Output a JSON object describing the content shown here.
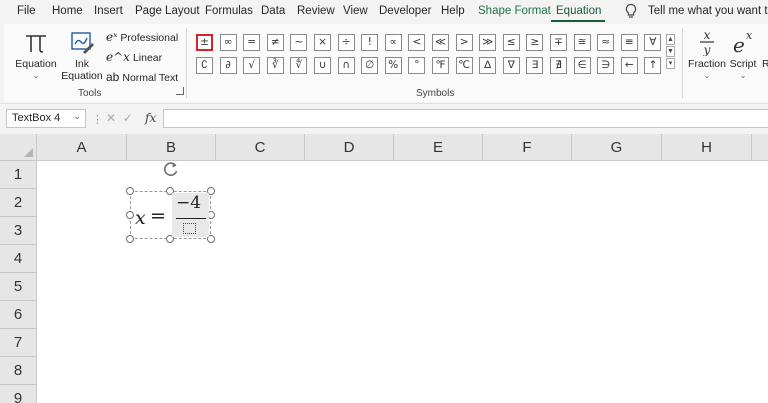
{
  "menu": {
    "tabs": [
      "File",
      "Home",
      "Insert",
      "Page Layout",
      "Formulas",
      "Data",
      "Review",
      "View",
      "Developer",
      "Help",
      "Shape Format",
      "Equation"
    ],
    "active_tab": "Equation",
    "tell_me": "Tell me what you want to d"
  },
  "ribbon": {
    "tools": {
      "equation_label": "Equation",
      "ink_label_1": "Ink",
      "ink_label_2": "Equation",
      "professional": "Professional",
      "linear": "Linear",
      "normal_text": "Normal Text",
      "group_label": "Tools"
    },
    "symbols": {
      "group_label": "Symbols",
      "row1": [
        "±",
        "∞",
        "=",
        "≠",
        "~",
        "×",
        "÷",
        "!",
        "∝",
        "<",
        "≪",
        ">",
        "≫",
        "≤",
        "≥",
        "∓",
        "≅",
        "≈",
        "≡",
        "∀"
      ],
      "row2": [
        "∁",
        "∂",
        "√",
        "∛",
        "∜",
        "∪",
        "∩",
        "∅",
        "%",
        "°",
        "℉",
        "℃",
        "∆",
        "∇",
        "∃",
        "∄",
        "∈",
        "∋",
        "←",
        "↑"
      ],
      "selected": "±"
    },
    "structures": {
      "fraction_label": "Fraction",
      "script_label": "Script",
      "radical_partial": "R"
    }
  },
  "formula_bar": {
    "name_box": "TextBox 4",
    "fx": "fx"
  },
  "sheet": {
    "columns": [
      "A",
      "B",
      "C",
      "D",
      "E",
      "F",
      "G",
      "H"
    ],
    "rows": [
      "1",
      "2",
      "3",
      "4",
      "5",
      "6",
      "7",
      "8",
      "9"
    ]
  },
  "equation": {
    "variable": "x",
    "equals": "=",
    "numerator": "−4"
  }
}
